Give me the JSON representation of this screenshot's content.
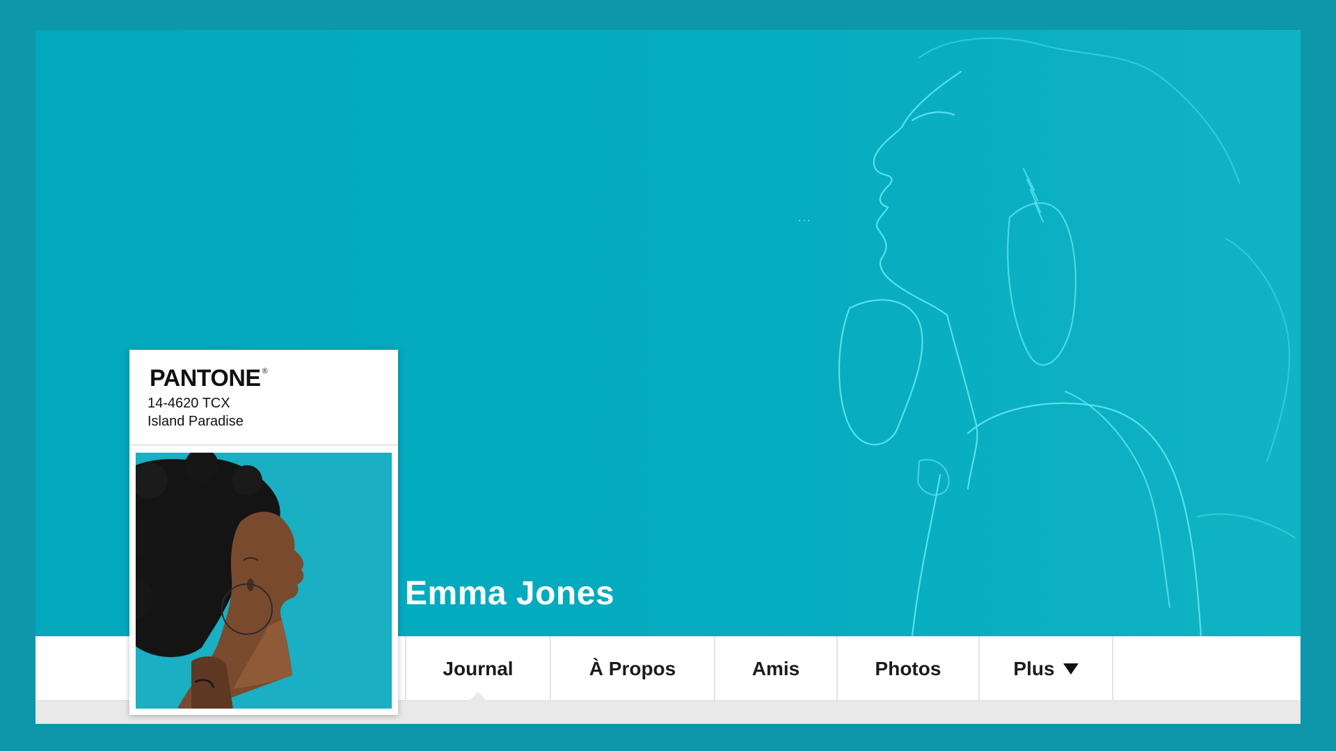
{
  "profile": {
    "name": "Emma Jones"
  },
  "swatch": {
    "brand": "PANTONE",
    "registered": "®",
    "code": "14-4620 TCX",
    "color_name": "Island Paradise"
  },
  "cover": {
    "dots": "..."
  },
  "nav": {
    "tabs": [
      {
        "label": "Journal",
        "active": true
      },
      {
        "label": "À Propos",
        "active": false
      },
      {
        "label": "Amis",
        "active": false
      },
      {
        "label": "Photos",
        "active": false
      },
      {
        "label": "Plus",
        "active": false,
        "icon": "caret-down-icon"
      }
    ]
  },
  "colors": {
    "background": "#0e97ab",
    "cover": "#05abbf",
    "swatch_color": "#1aafc2"
  }
}
